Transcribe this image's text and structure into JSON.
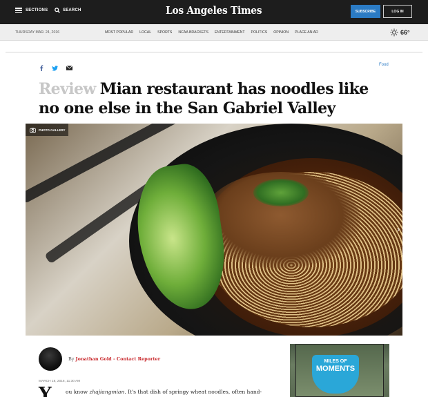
{
  "header": {
    "sections_label": "SECTIONS",
    "search_label": "SEARCH",
    "brand": "Los Angeles Times",
    "subscribe_label": "SUBSCRIBE",
    "login_label": "LOG IN"
  },
  "navbar": {
    "date": "THURSDAY MAR. 24, 2016",
    "links": [
      "MOST POPULAR",
      "LOCAL",
      "SPORTS",
      "NCAA BRACKETS",
      "ENTERTAINMENT",
      "POLITICS",
      "OPINION",
      "PLACE AN AD"
    ],
    "weather_icon": "sun-icon",
    "temperature": "66°"
  },
  "article": {
    "section": "Food",
    "share_icons": [
      "facebook-icon",
      "twitter-icon",
      "email-icon"
    ],
    "kicker": "Review",
    "headline": "Mian restaurant has noodles like no one else in the San Gabriel Valley",
    "gallery_label": "PHOTO GALLERY",
    "byline_prefix": "By",
    "author": "Jonathan Gold - Contact Reporter",
    "timestamp": "MARCH 18, 2016, 11:30 AM",
    "dropcap": "Y",
    "lead_pre": "ou know ",
    "lead_italic": "zhajiangmian",
    "lead_post": ". It's that dish of springy wheat noodles, often hand-"
  },
  "ad": {
    "line1": "MILES OF",
    "line2": "MOMENTS"
  }
}
